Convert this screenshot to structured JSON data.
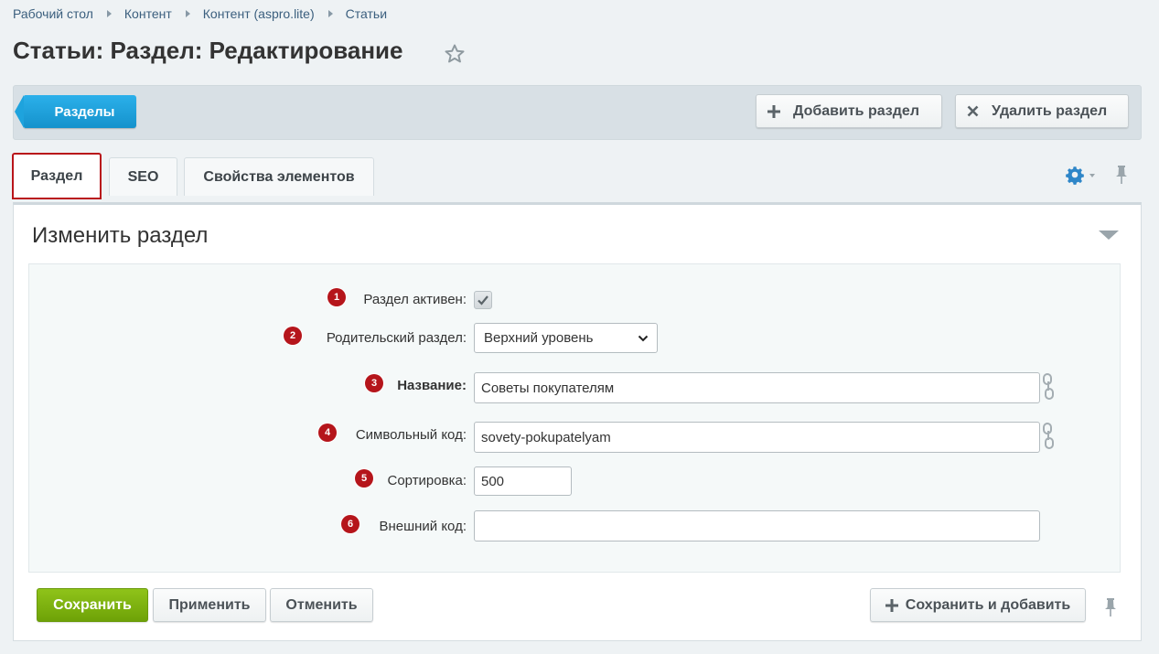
{
  "breadcrumb": [
    "Рабочий стол",
    "Контент",
    "Контент (aspro.lite)",
    "Статьи"
  ],
  "page_title": "Статьи: Раздел: Редактирование",
  "toolbar": {
    "sections_label": "Разделы",
    "add_label": "Добавить раздел",
    "delete_label": "Удалить раздел"
  },
  "tabs": [
    {
      "label": "Раздел",
      "active": true
    },
    {
      "label": "SEO",
      "active": false
    },
    {
      "label": "Свойства элементов",
      "active": false
    }
  ],
  "panel": {
    "title": "Изменить раздел"
  },
  "form": {
    "fields": [
      {
        "badge": "1",
        "label": "Раздел активен:",
        "type": "checkbox",
        "checked": true
      },
      {
        "badge": "2",
        "label": "Родительский раздел:",
        "type": "select",
        "value": "Верхний уровень"
      },
      {
        "badge": "3",
        "label": "Название:",
        "type": "text",
        "value": "Советы покупателям",
        "bold": true
      },
      {
        "badge": "4",
        "label": "Символьный код:",
        "type": "text",
        "value": "sovety-pokupatelyam"
      },
      {
        "badge": "5",
        "label": "Сортировка:",
        "type": "text",
        "value": "500"
      },
      {
        "badge": "6",
        "label": "Внешний код:",
        "type": "text",
        "value": ""
      }
    ]
  },
  "footer": {
    "save_label": "Сохранить",
    "apply_label": "Применить",
    "cancel_label": "Отменить",
    "save_add_label": "Сохранить и добавить"
  },
  "colors": {
    "accent_blue": "#1ea3dd",
    "save_green": "#7fb312",
    "badge_red": "#b5151b",
    "active_tab_border": "#b9141a"
  }
}
